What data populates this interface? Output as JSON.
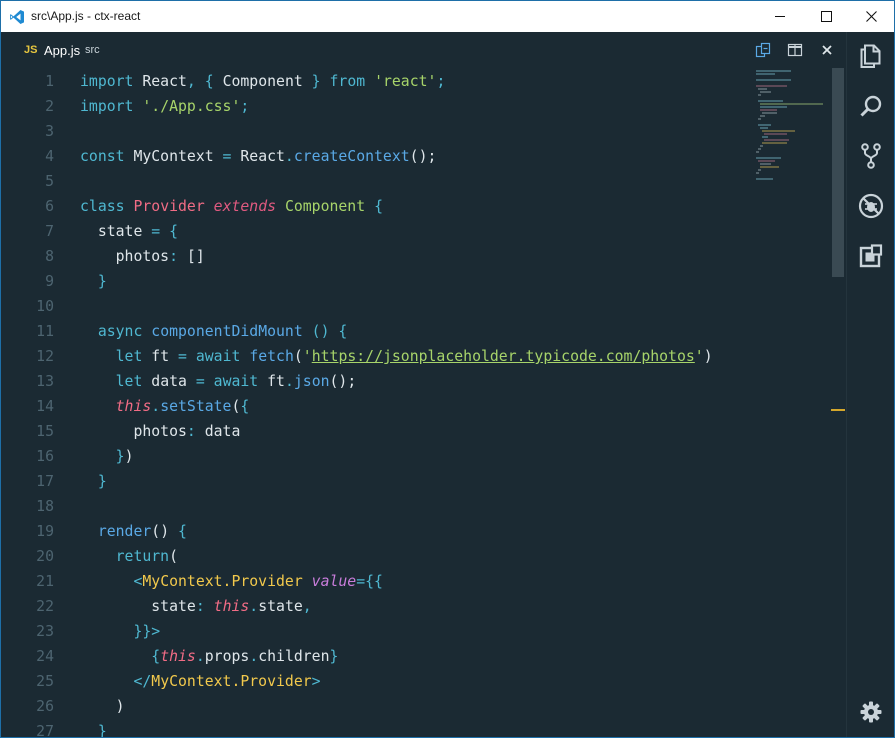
{
  "window": {
    "title": "src\\App.js - ctx-react"
  },
  "tab": {
    "badge": "JS",
    "name": "App.js",
    "path": "src"
  },
  "editor": {
    "lines": [
      {
        "n": "1",
        "tokens": [
          [
            "kw",
            "import"
          ],
          [
            "plain",
            " React"
          ],
          [
            "punc",
            ","
          ],
          [
            "plain",
            " "
          ],
          [
            "punc",
            "{"
          ],
          [
            "plain",
            " Component "
          ],
          [
            "punc",
            "}"
          ],
          [
            "plain",
            " "
          ],
          [
            "kw",
            "from"
          ],
          [
            "plain",
            " "
          ],
          [
            "str",
            "'react'"
          ],
          [
            "punc",
            ";"
          ]
        ]
      },
      {
        "n": "2",
        "tokens": [
          [
            "kw",
            "import"
          ],
          [
            "plain",
            " "
          ],
          [
            "str",
            "'./App.css'"
          ],
          [
            "punc",
            ";"
          ]
        ]
      },
      {
        "n": "3",
        "tokens": []
      },
      {
        "n": "4",
        "tokens": [
          [
            "kw",
            "const"
          ],
          [
            "plain",
            " MyContext "
          ],
          [
            "punc",
            "="
          ],
          [
            "plain",
            " React"
          ],
          [
            "punc",
            "."
          ],
          [
            "fn",
            "createContext"
          ],
          [
            "plain",
            "();"
          ]
        ]
      },
      {
        "n": "5",
        "tokens": []
      },
      {
        "n": "6",
        "tokens": [
          [
            "kw",
            "class"
          ],
          [
            "plain",
            " "
          ],
          [
            "cls",
            "Provider"
          ],
          [
            "plain",
            " "
          ],
          [
            "ext",
            "extends"
          ],
          [
            "plain",
            " "
          ],
          [
            "base",
            "Component"
          ],
          [
            "plain",
            " "
          ],
          [
            "punc",
            "{"
          ]
        ]
      },
      {
        "n": "7",
        "tokens": [
          [
            "plain",
            "  state "
          ],
          [
            "punc",
            "="
          ],
          [
            "plain",
            " "
          ],
          [
            "punc",
            "{"
          ]
        ]
      },
      {
        "n": "8",
        "tokens": [
          [
            "plain",
            "    photos"
          ],
          [
            "punc",
            ":"
          ],
          [
            "plain",
            " []"
          ]
        ]
      },
      {
        "n": "9",
        "tokens": [
          [
            "plain",
            "  "
          ],
          [
            "punc",
            "}"
          ]
        ]
      },
      {
        "n": "10",
        "tokens": []
      },
      {
        "n": "11",
        "tokens": [
          [
            "plain",
            "  "
          ],
          [
            "kw",
            "async"
          ],
          [
            "plain",
            " "
          ],
          [
            "fn",
            "componentDidMount"
          ],
          [
            "plain",
            " "
          ],
          [
            "punc",
            "()"
          ],
          [
            "plain",
            " "
          ],
          [
            "punc",
            "{"
          ]
        ]
      },
      {
        "n": "12",
        "tokens": [
          [
            "plain",
            "    "
          ],
          [
            "kw",
            "let"
          ],
          [
            "plain",
            " ft "
          ],
          [
            "punc",
            "="
          ],
          [
            "plain",
            " "
          ],
          [
            "kw",
            "await"
          ],
          [
            "plain",
            " "
          ],
          [
            "fn",
            "fetch"
          ],
          [
            "plain",
            "("
          ],
          [
            "str",
            "'"
          ],
          [
            "url",
            "https://jsonplaceholder.typicode.com/photos"
          ],
          [
            "str",
            "'"
          ],
          [
            "plain",
            ")"
          ]
        ]
      },
      {
        "n": "13",
        "tokens": [
          [
            "plain",
            "    "
          ],
          [
            "kw",
            "let"
          ],
          [
            "plain",
            " data "
          ],
          [
            "punc",
            "="
          ],
          [
            "plain",
            " "
          ],
          [
            "kw",
            "await"
          ],
          [
            "plain",
            " ft"
          ],
          [
            "punc",
            "."
          ],
          [
            "fn",
            "json"
          ],
          [
            "plain",
            "();"
          ]
        ]
      },
      {
        "n": "14",
        "tokens": [
          [
            "plain",
            "    "
          ],
          [
            "this",
            "this"
          ],
          [
            "punc",
            "."
          ],
          [
            "fn",
            "setState"
          ],
          [
            "plain",
            "("
          ],
          [
            "punc",
            "{"
          ]
        ]
      },
      {
        "n": "15",
        "tokens": [
          [
            "plain",
            "      photos"
          ],
          [
            "punc",
            ":"
          ],
          [
            "plain",
            " data"
          ]
        ]
      },
      {
        "n": "16",
        "tokens": [
          [
            "plain",
            "    "
          ],
          [
            "punc",
            "}"
          ],
          [
            "plain",
            ")"
          ]
        ]
      },
      {
        "n": "17",
        "tokens": [
          [
            "plain",
            "  "
          ],
          [
            "punc",
            "}"
          ]
        ]
      },
      {
        "n": "18",
        "tokens": []
      },
      {
        "n": "19",
        "tokens": [
          [
            "plain",
            "  "
          ],
          [
            "fn",
            "render"
          ],
          [
            "plain",
            "() "
          ],
          [
            "punc",
            "{"
          ]
        ]
      },
      {
        "n": "20",
        "tokens": [
          [
            "plain",
            "    "
          ],
          [
            "kw",
            "return"
          ],
          [
            "plain",
            "("
          ]
        ]
      },
      {
        "n": "21",
        "tokens": [
          [
            "plain",
            "      "
          ],
          [
            "punc",
            "<"
          ],
          [
            "jsx",
            "MyContext.Provider"
          ],
          [
            "plain",
            " "
          ],
          [
            "attr",
            "value"
          ],
          [
            "punc",
            "={{"
          ]
        ]
      },
      {
        "n": "22",
        "tokens": [
          [
            "plain",
            "        state"
          ],
          [
            "punc",
            ":"
          ],
          [
            "plain",
            " "
          ],
          [
            "this",
            "this"
          ],
          [
            "punc",
            "."
          ],
          [
            "plain",
            "state"
          ],
          [
            "punc",
            ","
          ]
        ]
      },
      {
        "n": "23",
        "tokens": [
          [
            "plain",
            "      "
          ],
          [
            "punc",
            "}}>"
          ]
        ]
      },
      {
        "n": "24",
        "tokens": [
          [
            "plain",
            "        "
          ],
          [
            "punc",
            "{"
          ],
          [
            "this",
            "this"
          ],
          [
            "punc",
            "."
          ],
          [
            "plain",
            "props"
          ],
          [
            "punc",
            "."
          ],
          [
            "plain",
            "children"
          ],
          [
            "punc",
            "}"
          ]
        ]
      },
      {
        "n": "25",
        "tokens": [
          [
            "plain",
            "      "
          ],
          [
            "punc",
            "</"
          ],
          [
            "jsx",
            "MyContext.Provider"
          ],
          [
            "punc",
            ">"
          ]
        ]
      },
      {
        "n": "26",
        "tokens": [
          [
            "plain",
            "    )"
          ]
        ]
      },
      {
        "n": "27",
        "tokens": [
          [
            "plain",
            "  "
          ],
          [
            "punc",
            "}"
          ]
        ]
      }
    ]
  },
  "colors": {
    "background": "#1b2a33",
    "keyword": "#4fb8d1",
    "string": "#a7d46a",
    "function": "#5aa9e6",
    "class": "#f16c85",
    "jsx_tag": "#f2c94c",
    "attribute": "#c97ddb",
    "line_number": "#4d6470"
  },
  "icons": {
    "app": "vscode-icon",
    "minimize": "minimize-icon",
    "maximize": "maximize-icon",
    "close": "close-icon",
    "open_changes": "open-changes-icon",
    "split_editor": "split-editor-icon",
    "close_editor": "close-editor-icon",
    "explorer": "files-icon",
    "search": "search-icon",
    "scm": "source-control-icon",
    "debug": "debug-icon",
    "extensions": "extensions-icon",
    "settings": "gear-icon"
  }
}
